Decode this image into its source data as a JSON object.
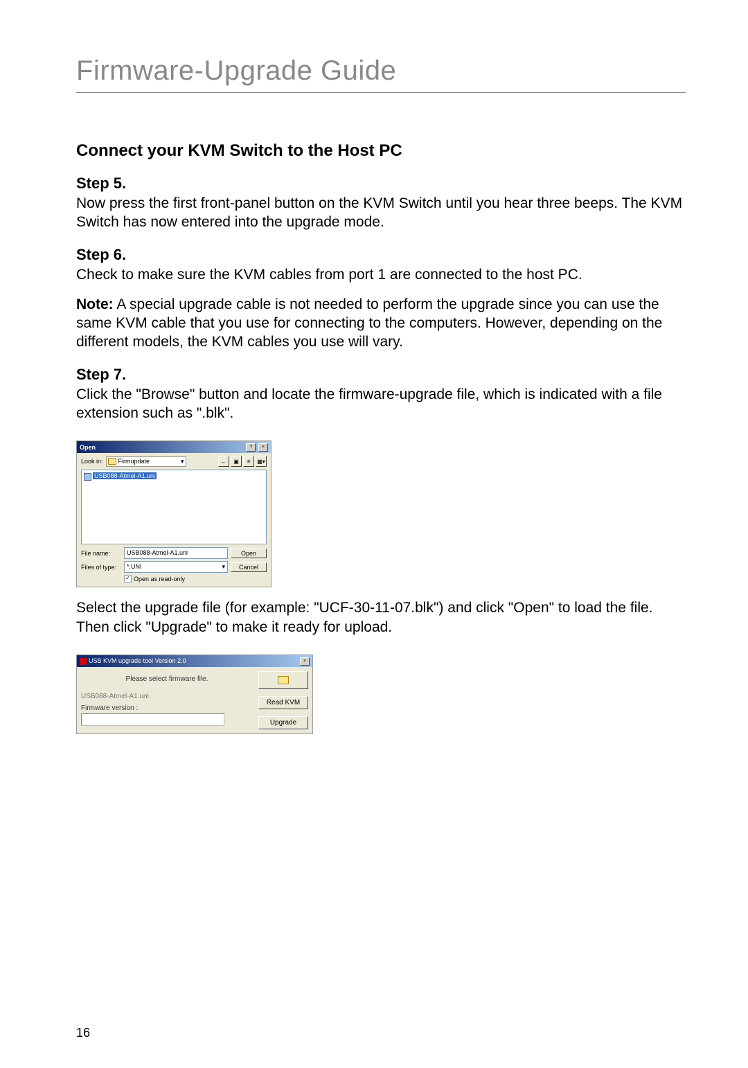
{
  "page": {
    "title": "Firmware-Upgrade Guide",
    "section_heading": "Connect your KVM Switch to the Host PC",
    "page_number": "16"
  },
  "steps": {
    "s5": {
      "heading": "Step 5.",
      "body": "Now press the first front-panel button on the KVM Switch until you hear three beeps. The KVM Switch has now entered into the upgrade mode."
    },
    "s6": {
      "heading": "Step 6.",
      "body": "Check to make sure the KVM cables from port 1 are connected to the host PC.",
      "note_label": "Note:",
      "note_body": " A special upgrade cable is not needed to perform the upgrade since you can use the same KVM cable that you use for connecting to the computers. However, depending on the different models, the KVM cables you use will vary."
    },
    "s7": {
      "heading": "Step 7.",
      "body": "Click the \"Browse\" button and locate the firmware-upgrade file, which is indicated with a file extension such as \".blk\".",
      "after": "Select the upgrade file (for example: \"UCF-30-11-07.blk\") and click \"Open\" to load the file. Then click \"Upgrade\" to make it ready for upload."
    }
  },
  "open_dialog": {
    "title": "Open",
    "help_btn": "?",
    "close_btn": "×",
    "look_in_label": "Look in:",
    "folder": "Firmupdate",
    "selected_file": "USB088-Atmel-A1.uni",
    "file_name_label": "File name:",
    "file_name_value": "USB088-Atmel-A1.uni",
    "files_of_type_label": "Files of type:",
    "files_of_type_value": "*.UNI",
    "open_btn": "Open",
    "cancel_btn": "Cancel",
    "readonly_label": "Open as read-only"
  },
  "tool_dialog": {
    "title": "USB KVM upgrade tool Version 2.0",
    "close_btn": "×",
    "prompt": "Please select firmware file.",
    "file_line": "USB088-Atmel-A1.uni",
    "fw_label": "Firmware version :",
    "read_btn": "Read KVM",
    "upgrade_btn": "Upgrade"
  }
}
